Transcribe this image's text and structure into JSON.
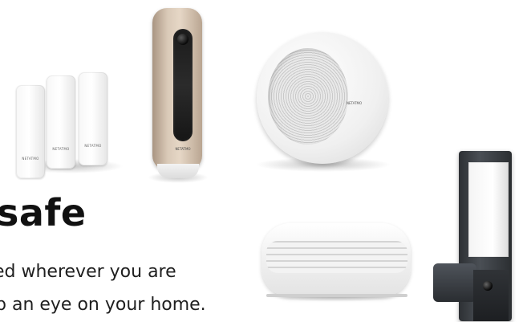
{
  "hero": {
    "headline": "safe",
    "line1": "ed wherever you are",
    "line2": "p an eye on your home."
  },
  "products": {
    "sensor_brand": "NETATMO",
    "camera_brand": "NETATMO",
    "siren_brand": "NETATMO"
  },
  "colors": {
    "text": "#111111",
    "background": "#ffffff",
    "camera_gold": "#d9c9b7",
    "outdoor_camera": "#3a3e43"
  }
}
